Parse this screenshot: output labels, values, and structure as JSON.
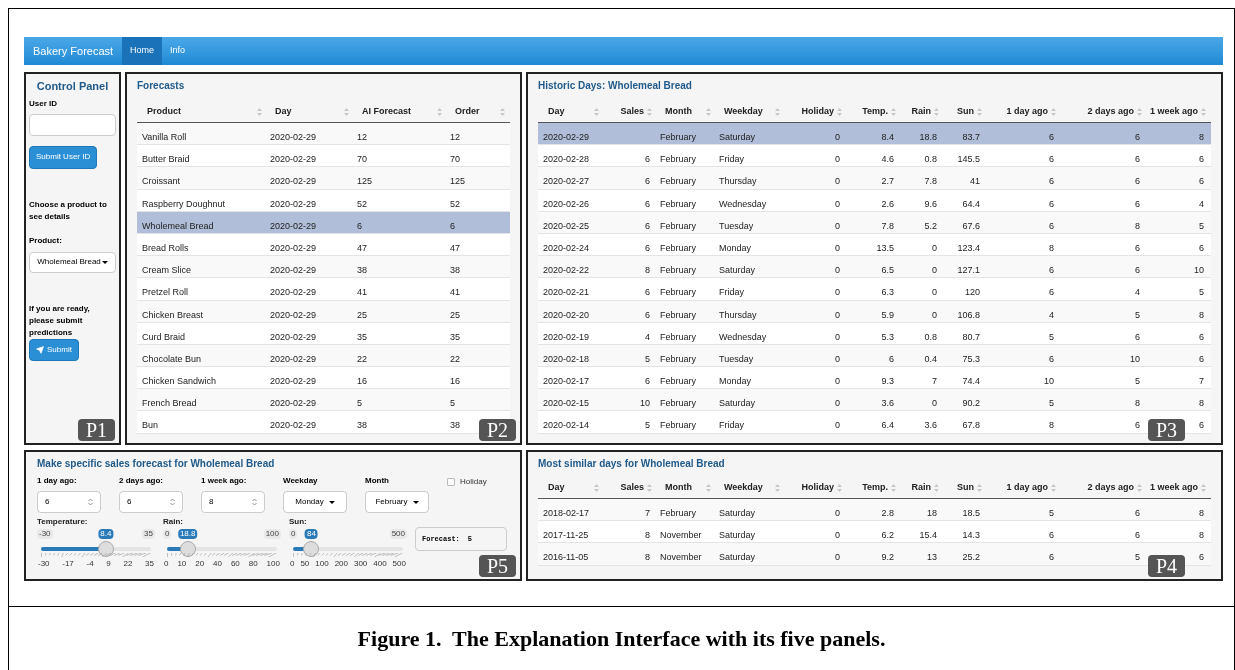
{
  "navbar": {
    "brand": "Bakery Forecast",
    "tabs": [
      {
        "label": "Home",
        "selected": true
      },
      {
        "label": "Info",
        "selected": false
      }
    ]
  },
  "control_panel": {
    "title": "Control Panel",
    "user_id_label": "User ID",
    "submit_user_button": "Submit User ID",
    "choose_text": "Choose a product to see details",
    "product_label": "Product:",
    "product_value": "Wholemeal Bread",
    "ready_text": "If you are ready, please submit predictions",
    "submit_button": "Submit",
    "panel_tag": "P1"
  },
  "forecasts": {
    "title": "Forecasts",
    "panel_tag": "P2",
    "columns": [
      "Product",
      "Day",
      "AI Forecast",
      "Order"
    ],
    "rows": [
      {
        "cells": [
          "Vanilla Roll",
          "2020-02-29",
          "12",
          "12"
        ],
        "selected": false
      },
      {
        "cells": [
          "Butter Braid",
          "2020-02-29",
          "70",
          "70"
        ],
        "selected": false
      },
      {
        "cells": [
          "Croissant",
          "2020-02-29",
          "125",
          "125"
        ],
        "selected": false
      },
      {
        "cells": [
          "Raspberry Doughnut",
          "2020-02-29",
          "52",
          "52"
        ],
        "selected": false
      },
      {
        "cells": [
          "Wholemeal Bread",
          "2020-02-29",
          "6",
          "6"
        ],
        "selected": true
      },
      {
        "cells": [
          "Bread Rolls",
          "2020-02-29",
          "47",
          "47"
        ],
        "selected": false
      },
      {
        "cells": [
          "Cream Slice",
          "2020-02-29",
          "38",
          "38"
        ],
        "selected": false
      },
      {
        "cells": [
          "Pretzel Roll",
          "2020-02-29",
          "41",
          "41"
        ],
        "selected": false
      },
      {
        "cells": [
          "Chicken Breast",
          "2020-02-29",
          "25",
          "25"
        ],
        "selected": false
      },
      {
        "cells": [
          "Curd Braid",
          "2020-02-29",
          "35",
          "35"
        ],
        "selected": false
      },
      {
        "cells": [
          "Chocolate Bun",
          "2020-02-29",
          "22",
          "22"
        ],
        "selected": false
      },
      {
        "cells": [
          "Chicken Sandwich",
          "2020-02-29",
          "16",
          "16"
        ],
        "selected": false
      },
      {
        "cells": [
          "French Bread",
          "2020-02-29",
          "5",
          "5"
        ],
        "selected": false
      },
      {
        "cells": [
          "Bun",
          "2020-02-29",
          "38",
          "38"
        ],
        "selected": false
      }
    ]
  },
  "historic_days": {
    "title": "Historic Days: Wholemeal Bread",
    "panel_tag": "P3",
    "columns": [
      "Day",
      "Sales",
      "Month",
      "Weekday",
      "Holiday",
      "Temp.",
      "Rain",
      "Sun",
      "1 day ago",
      "2 days ago",
      "1 week ago"
    ],
    "rows": [
      {
        "cells": [
          "2020-02-29",
          null,
          "February",
          "Saturday",
          "0",
          "8.4",
          "18.8",
          "83.7",
          "6",
          "6",
          "8"
        ],
        "selected": true
      },
      {
        "cells": [
          "2020-02-28",
          "6",
          "February",
          "Friday",
          "0",
          "4.6",
          "0.8",
          "145.5",
          "6",
          "6",
          "6"
        ],
        "selected": false
      },
      {
        "cells": [
          "2020-02-27",
          "6",
          "February",
          "Thursday",
          "0",
          "2.7",
          "7.8",
          "41",
          "6",
          "6",
          "6"
        ],
        "selected": false
      },
      {
        "cells": [
          "2020-02-26",
          "6",
          "February",
          "Wednesday",
          "0",
          "2.6",
          "9.6",
          "64.4",
          "6",
          "6",
          "4"
        ],
        "selected": false
      },
      {
        "cells": [
          "2020-02-25",
          "6",
          "February",
          "Tuesday",
          "0",
          "7.8",
          "5.2",
          "67.6",
          "6",
          "8",
          "5"
        ],
        "selected": false
      },
      {
        "cells": [
          "2020-02-24",
          "6",
          "February",
          "Monday",
          "0",
          "13.5",
          "0",
          "123.4",
          "8",
          "6",
          "6"
        ],
        "selected": false
      },
      {
        "cells": [
          "2020-02-22",
          "8",
          "February",
          "Saturday",
          "0",
          "6.5",
          "0",
          "127.1",
          "6",
          "6",
          "10"
        ],
        "selected": false
      },
      {
        "cells": [
          "2020-02-21",
          "6",
          "February",
          "Friday",
          "0",
          "6.3",
          "0",
          "120",
          "6",
          "4",
          "5"
        ],
        "selected": false
      },
      {
        "cells": [
          "2020-02-20",
          "6",
          "February",
          "Thursday",
          "0",
          "5.9",
          "0",
          "106.8",
          "4",
          "5",
          "8"
        ],
        "selected": false
      },
      {
        "cells": [
          "2020-02-19",
          "4",
          "February",
          "Wednesday",
          "0",
          "5.3",
          "0.8",
          "80.7",
          "5",
          "6",
          "6"
        ],
        "selected": false
      },
      {
        "cells": [
          "2020-02-18",
          "5",
          "February",
          "Tuesday",
          "0",
          "6",
          "0.4",
          "75.3",
          "6",
          "10",
          "6"
        ],
        "selected": false
      },
      {
        "cells": [
          "2020-02-17",
          "6",
          "February",
          "Monday",
          "0",
          "9.3",
          "7",
          "74.4",
          "10",
          "5",
          "7"
        ],
        "selected": false
      },
      {
        "cells": [
          "2020-02-15",
          "10",
          "February",
          "Saturday",
          "0",
          "3.6",
          "0",
          "90.2",
          "5",
          "8",
          "8"
        ],
        "selected": false
      },
      {
        "cells": [
          "2020-02-14",
          "5",
          "February",
          "Friday",
          "0",
          "6.4",
          "3.6",
          "67.8",
          "8",
          "6",
          "6"
        ],
        "selected": false
      }
    ]
  },
  "specific_forecast": {
    "title": "Make specific sales forecast for Wholemeal Bread",
    "panel_tag": "P5",
    "number_inputs": [
      {
        "label": "1 day ago:",
        "value": "6"
      },
      {
        "label": "2 days ago:",
        "value": "6"
      },
      {
        "label": "1 week ago:",
        "value": "8"
      }
    ],
    "selects": [
      {
        "label": "Weekday",
        "value": "Monday"
      },
      {
        "label": "Month",
        "value": "February"
      }
    ],
    "holiday": {
      "label": "Holiday",
      "checked": false
    },
    "sliders": [
      {
        "label": "Temperature:",
        "min": "-30",
        "max": "35",
        "value": "8.4",
        "level": 0.59,
        "ticks": [
          "-30",
          "-17",
          "-4",
          "9",
          "22",
          "35"
        ]
      },
      {
        "label": "Rain:",
        "min": "0",
        "max": "100",
        "value": "18.8",
        "level": 0.188,
        "ticks": [
          "0",
          "10",
          "20",
          "40",
          "60",
          "80",
          "100"
        ]
      },
      {
        "label": "Sun:",
        "min": "0",
        "max": "500",
        "value": "84",
        "level": 0.168,
        "ticks": [
          "0",
          "50",
          "100",
          "200",
          "300",
          "400",
          "500"
        ]
      }
    ],
    "forecast": {
      "label": "Forecast:",
      "value": "5"
    }
  },
  "similar_days": {
    "title": "Most similar days for Wholemeal Bread",
    "panel_tag": "P4",
    "columns": [
      "Day",
      "Sales",
      "Month",
      "Weekday",
      "Holiday",
      "Temp.",
      "Rain",
      "Sun",
      "1 day ago",
      "2 days ago",
      "1 week ago"
    ],
    "rows": [
      {
        "cells": [
          "2018-02-17",
          "7",
          "February",
          "Saturday",
          "0",
          "2.8",
          "18",
          "18.5",
          "5",
          "6",
          "8"
        ],
        "selected": false
      },
      {
        "cells": [
          "2017-11-25",
          "8",
          "November",
          "Saturday",
          "0",
          "6.2",
          "15.4",
          "14.3",
          "6",
          "6",
          "8"
        ],
        "selected": false
      },
      {
        "cells": [
          "2016-11-05",
          "8",
          "November",
          "Saturday",
          "0",
          "9.2",
          "13",
          "25.2",
          "6",
          "5",
          "6"
        ],
        "selected": false
      }
    ]
  },
  "caption": "Figure 1.  The Explanation Interface with its five panels."
}
